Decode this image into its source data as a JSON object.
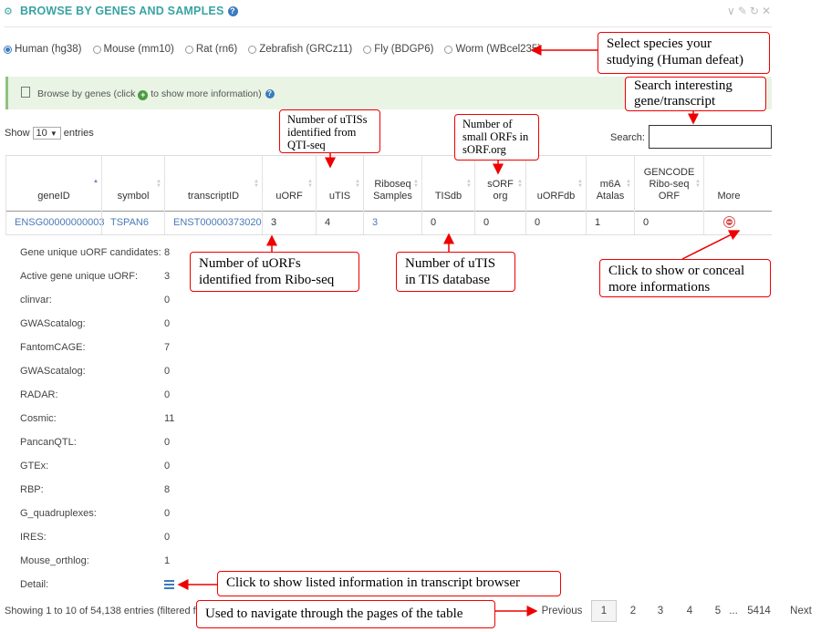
{
  "header": {
    "title": "BROWSE BY GENES AND SAMPLES",
    "help_icon": "question-circle-icon",
    "window_icons": [
      "chevron-down-icon",
      "wrench-icon",
      "refresh-icon",
      "close-icon"
    ]
  },
  "species": [
    {
      "label": "Human (hg38)",
      "selected": true
    },
    {
      "label": "Mouse (mm10)",
      "selected": false
    },
    {
      "label": "Rat (rn6)",
      "selected": false
    },
    {
      "label": "Zebrafish (GRCz11)",
      "selected": false
    },
    {
      "label": "Fly (BDGP6)",
      "selected": false
    },
    {
      "label": "Worm (WBcel235)",
      "selected": false
    }
  ],
  "info": {
    "prefix": "Browse by genes (click",
    "suffix": "to show more information)"
  },
  "length": {
    "show": "Show",
    "value": "10",
    "entries": "entries"
  },
  "search": {
    "label": "Search:"
  },
  "table": {
    "columns": [
      {
        "label": "geneID",
        "sort": "asc"
      },
      {
        "label": "symbol",
        "sort": "both"
      },
      {
        "label": "transcriptID",
        "sort": "both"
      },
      {
        "label": "uORF",
        "sort": "both"
      },
      {
        "label": "uTIS",
        "sort": "both"
      },
      {
        "label": "Riboseq Samples",
        "sort": "both"
      },
      {
        "label": "TISdb",
        "sort": "both"
      },
      {
        "label": "sORF org",
        "sort": "both"
      },
      {
        "label": "uORFdb",
        "sort": "both"
      },
      {
        "label": "m6A Atalas",
        "sort": "both"
      },
      {
        "label": "GENCODE Ribo-seq ORF",
        "sort": "both"
      },
      {
        "label": "More",
        "sort": "none"
      }
    ],
    "row": [
      "ENSG00000000003",
      "TSPAN6",
      "ENST00000373020",
      "3",
      "4",
      "3",
      "0",
      "0",
      "0",
      "1",
      "0"
    ]
  },
  "details": [
    {
      "label": "Gene unique uORF candidates:",
      "value": "8"
    },
    {
      "label": "Active gene unique uORF:",
      "value": "3"
    },
    {
      "label": "clinvar:",
      "value": "0"
    },
    {
      "label": "GWAScatalog:",
      "value": "0"
    },
    {
      "label": "FantomCAGE:",
      "value": "7"
    },
    {
      "label": "GWAScatalog:",
      "value": "0"
    },
    {
      "label": "RADAR:",
      "value": "0"
    },
    {
      "label": "Cosmic:",
      "value": "11"
    },
    {
      "label": "PancanQTL:",
      "value": "0"
    },
    {
      "label": "GTEx:",
      "value": "0"
    },
    {
      "label": "RBP:",
      "value": "8"
    },
    {
      "label": "G_quadruplexes:",
      "value": "0"
    },
    {
      "label": "IRES:",
      "value": "0"
    },
    {
      "label": "Mouse_orthlog:",
      "value": "1"
    },
    {
      "label": "Detail:",
      "value": ""
    }
  ],
  "footer": {
    "info": "Showing 1 to 10 of 54,138 entries (filtered f"
  },
  "pagination": {
    "previous": "Previous",
    "pages": [
      "1",
      "2",
      "3",
      "4",
      "5",
      "...",
      "5414"
    ],
    "next": "Next",
    "current": "1"
  },
  "annotations": {
    "species": "Select species your studying (Human defeat)",
    "search": "Search interesting gene/transcript",
    "utis": "Number of uTISs identified from QTI-seq",
    "sorf": "Number of small ORFs in sORF.org",
    "uorf": "Number of uORFs identified from Ribo-seq",
    "tisdb": "Number of uTIS in TIS database",
    "more": "Click to show or conceal more informations",
    "detail": "Click to show listed information in transcript browser",
    "pages": "Used to navigate through the pages of the table"
  },
  "colors": {
    "accent": "#3aa3a3",
    "link": "#4a79b8",
    "annotation": "#e00000",
    "info_bg": "#e9f4e4"
  }
}
